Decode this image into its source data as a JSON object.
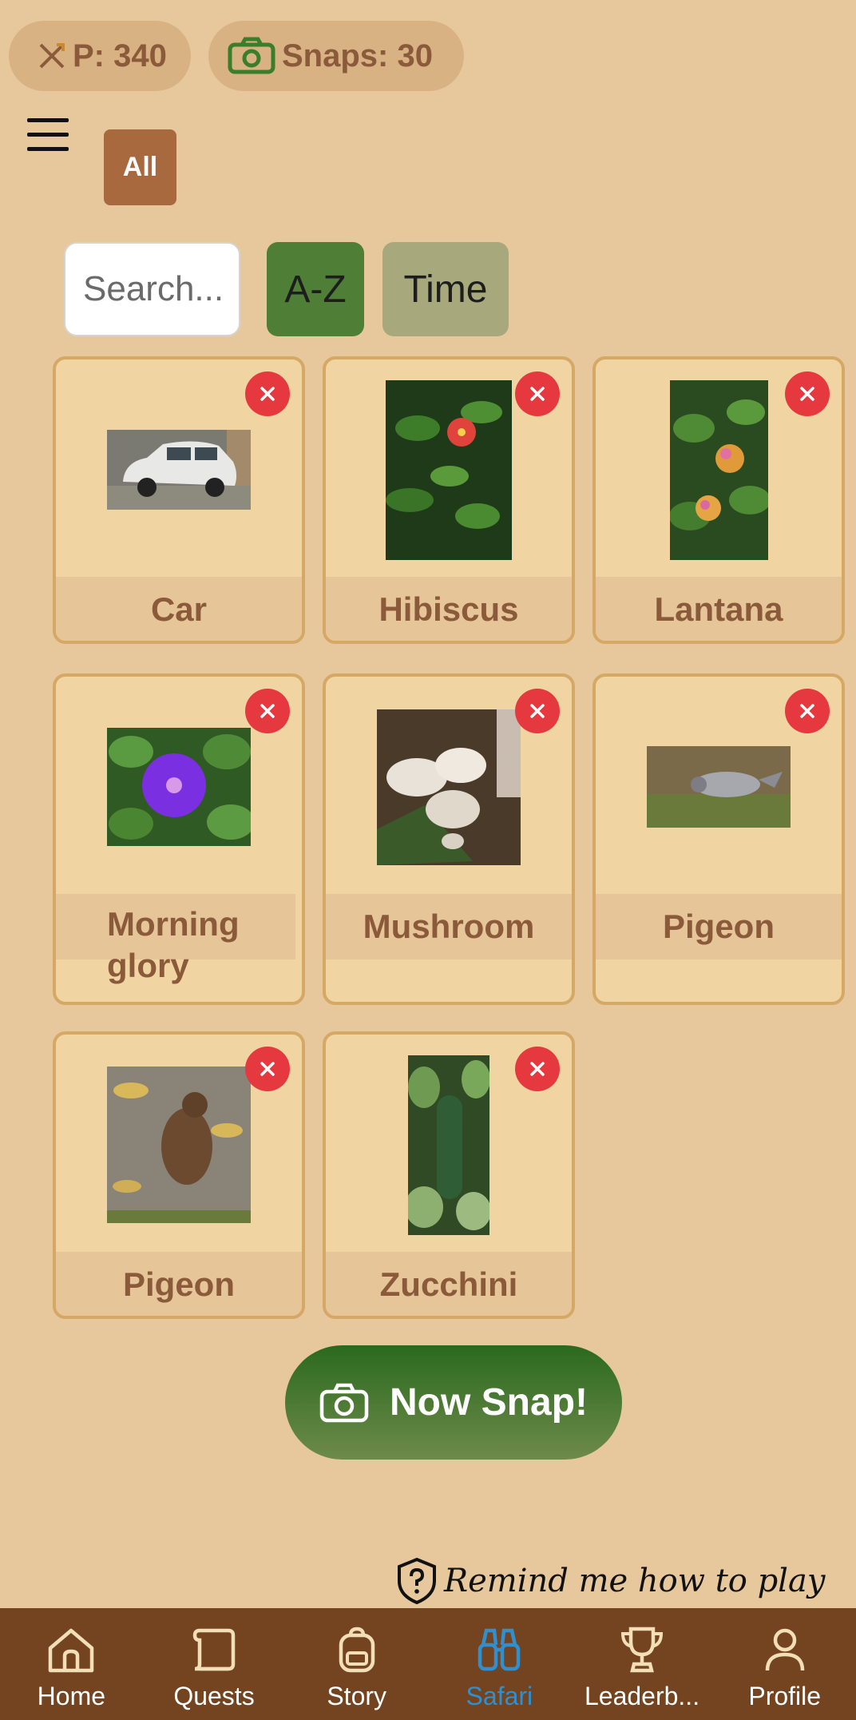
{
  "header": {
    "points_text": "P: 340",
    "snaps_text": "Snaps: 30"
  },
  "filters": {
    "all_label": "All"
  },
  "toolbar": {
    "search_placeholder": "Search...",
    "sort_az_label": "A-Z",
    "sort_time_label": "Time"
  },
  "cards": [
    {
      "name": "Car"
    },
    {
      "name": "Hibiscus"
    },
    {
      "name": "Lantana"
    },
    {
      "name": "Morning glory"
    },
    {
      "name": "Mushroom"
    },
    {
      "name": "Pigeon"
    },
    {
      "name": "Pigeon"
    },
    {
      "name": "Zucchini"
    }
  ],
  "actions": {
    "snap_label": "Now Snap!",
    "remind_label": "Remind me how to play"
  },
  "nav": {
    "items": [
      {
        "label": "Home",
        "icon": "home-icon"
      },
      {
        "label": "Quests",
        "icon": "scroll-icon"
      },
      {
        "label": "Story",
        "icon": "backpack-icon"
      },
      {
        "label": "Safari",
        "icon": "binoculars-icon",
        "active": true
      },
      {
        "label": "Leaderb...",
        "icon": "trophy-icon"
      },
      {
        "label": "Profile",
        "icon": "person-icon"
      }
    ]
  },
  "colors": {
    "background": "#e6c89c",
    "card_bg": "#f0d4a2",
    "card_border": "#d6a866",
    "accent_green": "#4f7f37",
    "close_red": "#e5393f",
    "nav_bg": "#744421",
    "nav_active": "#2f8fcf"
  }
}
